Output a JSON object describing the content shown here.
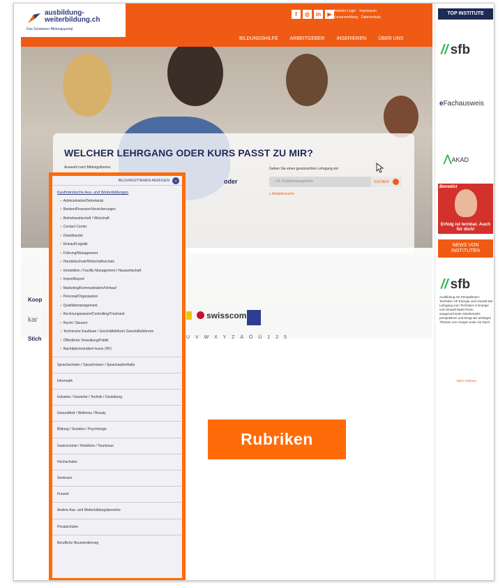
{
  "header": {
    "logo_line1": "ausbildung-",
    "logo_line2": "weiterbildung.ch",
    "logo_tagline": "Das Schweizer Bildungsportal",
    "social": [
      "f",
      "◎",
      "in",
      "▶"
    ],
    "toplinks": [
      "Anbieter Login",
      "Impressum",
      "Kursanmeldung",
      "Datenschutz"
    ],
    "nav": [
      "BILDUNGSHILFE",
      "ARBEITGEBER",
      "INSERIEREN",
      "ÜBER UNS"
    ]
  },
  "hero": {
    "title": "WELCHER LEHRGANG ODER KURS PASST ZU MIR?",
    "select_label": "Auswahl nach Bildungsthema:",
    "oder": "oder",
    "search_label": "Geben Sie einen gewünschten Lehrgang ein:",
    "search_placeholder": "z.B. Projektmanagement",
    "search_button": "SUCHEN",
    "anbieter_link": "» Anbietersuche"
  },
  "lower": {
    "koop": "Koop",
    "kar": "kar",
    "stich": "Stich",
    "swisscom": "swisscom",
    "alphabet": "U V W X Y Z Ä Ö Ü 1 2 5"
  },
  "menu": {
    "header": "BILDUNGSTHEMEN ANZEIGEN",
    "first_category": "Kaufmännische Aus- und Weiterbildungen",
    "subitems": [
      "Administration/Sekretariat",
      "Banken/Finanzen/Versicherungen",
      "Betriebswirtschaft / Wirtschaft",
      "Contact Center",
      "Detailhandel",
      "Einkauf/Logistik",
      "Führung/Management",
      "Handelsschule/Wirtschaftsschule",
      "Immobilien / Facility Management / Hauswirtschaft",
      "Import/Export",
      "Marketing/Kommunikation/Verkauf",
      "Personal/Organisation",
      "Qualitätsmanagement",
      "Rechnungswesen/Controlling/Treuhand",
      "Recht / Steuern",
      "Technische Kaufleute / Geschäftsführer/ Geschäftsführerin",
      "Öffentliche Verwaltung/Politik",
      "Nachdiplomstudien/-kurse (HF)"
    ],
    "categories": [
      "Sprachschulen / Sprachreisen / Sprachaufenthalte",
      "Informatik",
      "Industrie / Gewerbe / Technik / Gestaltung",
      "Gesundheit / Wellness / Beauty",
      "Bildung / Soziales / Psychologie",
      "Gastronomie / Hotellerie / Tourismus",
      "Hochschulen",
      "Seminare",
      "Freizeit",
      "Andere Aus- und Weiterbildungsbereiche",
      "Privatschulen",
      "Berufliche Neuorientierung"
    ]
  },
  "callout": {
    "label": "Rubriken"
  },
  "sidebar": {
    "top_institute": "TOP INSTITUTE",
    "sfb": "sfb",
    "efach_e": "e",
    "efach_rest": "Fachausweis",
    "akad": "AKAD",
    "benedict_title": "Benedict",
    "benedict_claim": "Erfolg ist lernbar. Auch für dich!",
    "news": "NEWS VON INSTITUTEN",
    "text": "Ausbildung mit Perspektiven: Techniker HF Energie und Umwelt Der Lehrgang zum Techniker in Energie und Umwelt bietet Ihnen ausgezeichnete Arbeitsmarkt- perspektiven und bringt die wichtigen Themen von morgen unter ein Dach.",
    "more": "Mehr erfahren"
  },
  "colors": {
    "accent": "#ef5b14",
    "callout": "#ff6b08",
    "navy": "#1f2a55",
    "green": "#2db34a"
  }
}
